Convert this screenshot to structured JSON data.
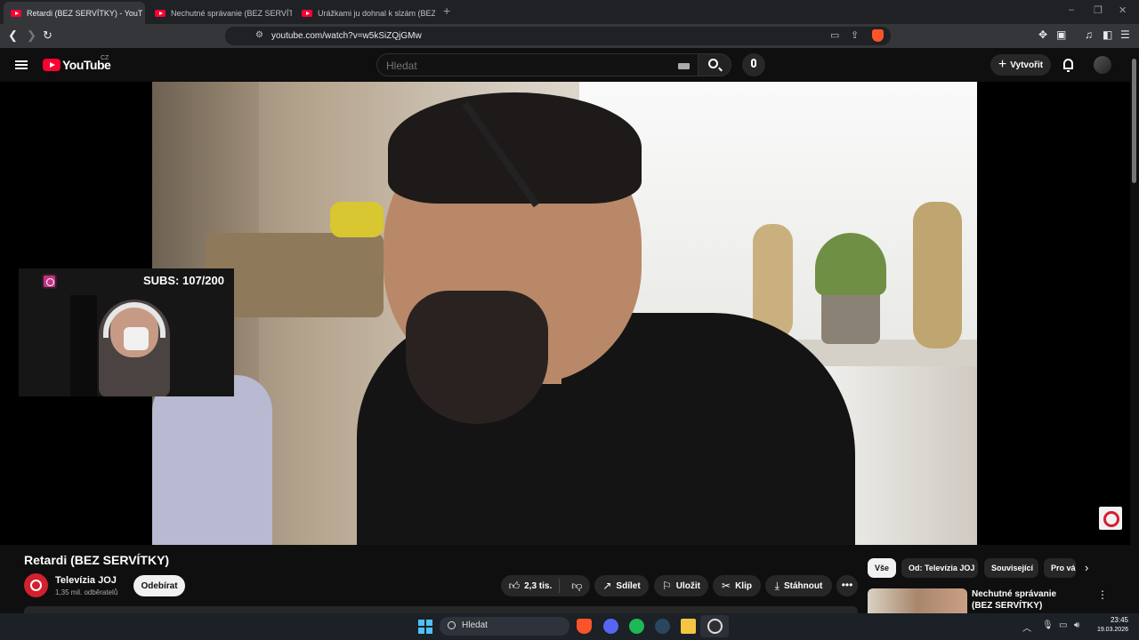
{
  "browser": {
    "tabs": [
      {
        "label": "Retardi (BEZ SERVÍTKY) - YouT",
        "active": true
      },
      {
        "label": "Nechutné správanie (BEZ SERVÍTKY)",
        "active": false
      },
      {
        "label": "Urážkami ju dohnal k slzám (BEZ SER",
        "active": false
      }
    ],
    "tab_close_glyph": "✕",
    "new_tab_glyph": "+",
    "window_controls": [
      "–",
      "❐",
      "✕"
    ],
    "url": "youtube.com/watch?v=w5kSiZQjGMw"
  },
  "youtube": {
    "logo_text": "YouTube",
    "country_code": "CZ",
    "search_placeholder": "Hledat",
    "create_label": "Vytvořit"
  },
  "overlay": {
    "subs_counter": "SUBS: 107/200"
  },
  "video": {
    "title": "Retardi (BEZ SERVÍTKY)",
    "channel_name": "Televízia JOJ",
    "channel_subscribers": "1,35 mil. odběratelů",
    "subscribe_label": "Odebírat",
    "like_count": "2,3 tis.",
    "share_label": "Sdílet",
    "save_label": "Uložit",
    "clip_label": "Klip",
    "download_label": "Stáhnout",
    "more_glyph": "•••"
  },
  "sidebar": {
    "chips": [
      "Vše",
      "Od: Televízia JOJ",
      "Související",
      "Pro vás"
    ],
    "next_glyph": "›",
    "recommendation": {
      "title": "Nechutné správanie (BEZ SERVÍTKY)",
      "menu_glyph": "⋮"
    }
  },
  "taskbar": {
    "search_placeholder": "Hledat",
    "time": "23:45",
    "date": "19.03.2026"
  },
  "colors": {
    "youtube_red": "#ff0033",
    "joj_red": "#d2202f",
    "background": "#0f0f0f"
  }
}
